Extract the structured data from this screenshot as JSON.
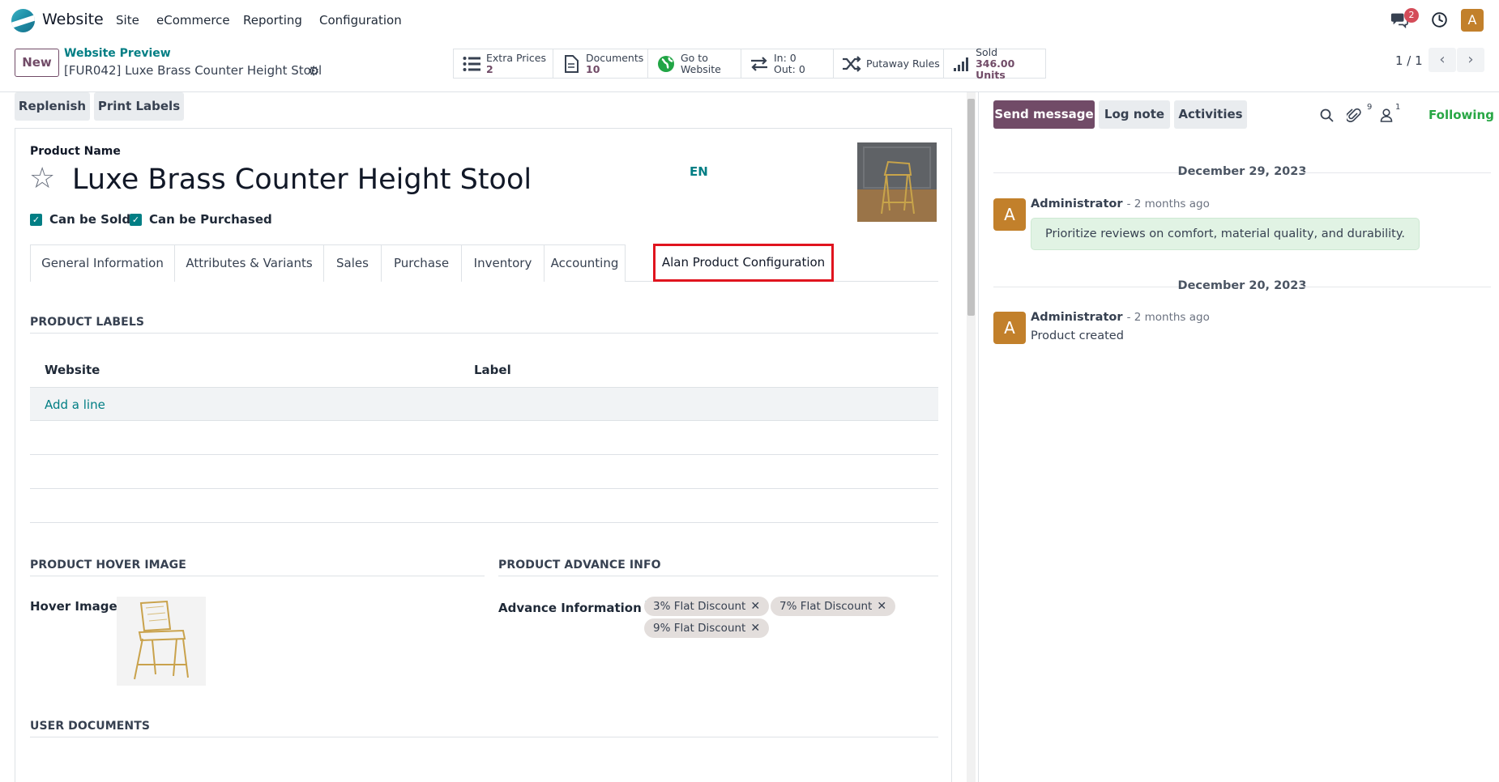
{
  "topnav": {
    "app_name": "Website",
    "menus": [
      "Site",
      "eCommerce",
      "Reporting",
      "Configuration"
    ],
    "message_count": "2",
    "avatar_letter": "A"
  },
  "control_panel": {
    "new_label": "New",
    "breadcrumb_parent": "Website Preview",
    "breadcrumb_current": "[FUR042] Luxe Brass Counter Height Stool",
    "smart_buttons": [
      {
        "icon": "list-icon",
        "label": "Extra Prices",
        "value": "2"
      },
      {
        "icon": "document-icon",
        "label": "Documents",
        "value": "10"
      },
      {
        "icon": "globe-icon",
        "label": "Go to",
        "value": "Website"
      },
      {
        "icon": "transfer-icon",
        "label": "In: 0",
        "value": "Out: 0"
      },
      {
        "icon": "shuffle-icon",
        "label": "Putaway Rules",
        "value": ""
      },
      {
        "icon": "bar-chart-icon",
        "label": "Sold",
        "value": "346.00 Units"
      }
    ],
    "pager": "1 / 1"
  },
  "actions": {
    "replenish": "Replenish",
    "print_labels": "Print Labels"
  },
  "form": {
    "product_name_label": "Product Name",
    "product_name": "Luxe Brass Counter Height Stool",
    "lang": "EN",
    "can_be_sold": "Can be Sold",
    "can_be_purchased": "Can be Purchased",
    "tabs": [
      "General Information",
      "Attributes & Variants",
      "Sales",
      "Purchase",
      "Inventory",
      "Accounting",
      "Alan Product Configuration"
    ],
    "active_tab": "Alan Product Configuration",
    "labels_section": "PRODUCT LABELS",
    "col_website": "Website",
    "col_label": "Label",
    "add_line": "Add a line",
    "hover_section": "PRODUCT HOVER IMAGE",
    "hover_label": "Hover Image",
    "advance_section": "PRODUCT ADVANCE INFO",
    "advance_label": "Advance Information",
    "advance_help": "?",
    "tags": [
      "3% Flat Discount",
      "7% Flat Discount",
      "9% Flat Discount"
    ],
    "docs_section": "USER DOCUMENTS"
  },
  "chatter": {
    "send_message": "Send message",
    "log_note": "Log note",
    "activities": "Activities",
    "attachments_count": "9",
    "followers_count": "1",
    "following": "Following",
    "messages": [
      {
        "date": "December 29, 2023",
        "author": "Administrator",
        "ago": "- 2 months ago",
        "body": "Prioritize reviews on comfort, material quality, and durability.",
        "avatar": "A"
      },
      {
        "date": "December 20, 2023",
        "author": "Administrator",
        "ago": "- 2 months ago",
        "body": "Product created",
        "avatar": "A"
      }
    ]
  },
  "colors": {
    "primary": "#714b67",
    "teal": "#017e84",
    "highlight": "#e0141e",
    "following": "#28a745"
  }
}
